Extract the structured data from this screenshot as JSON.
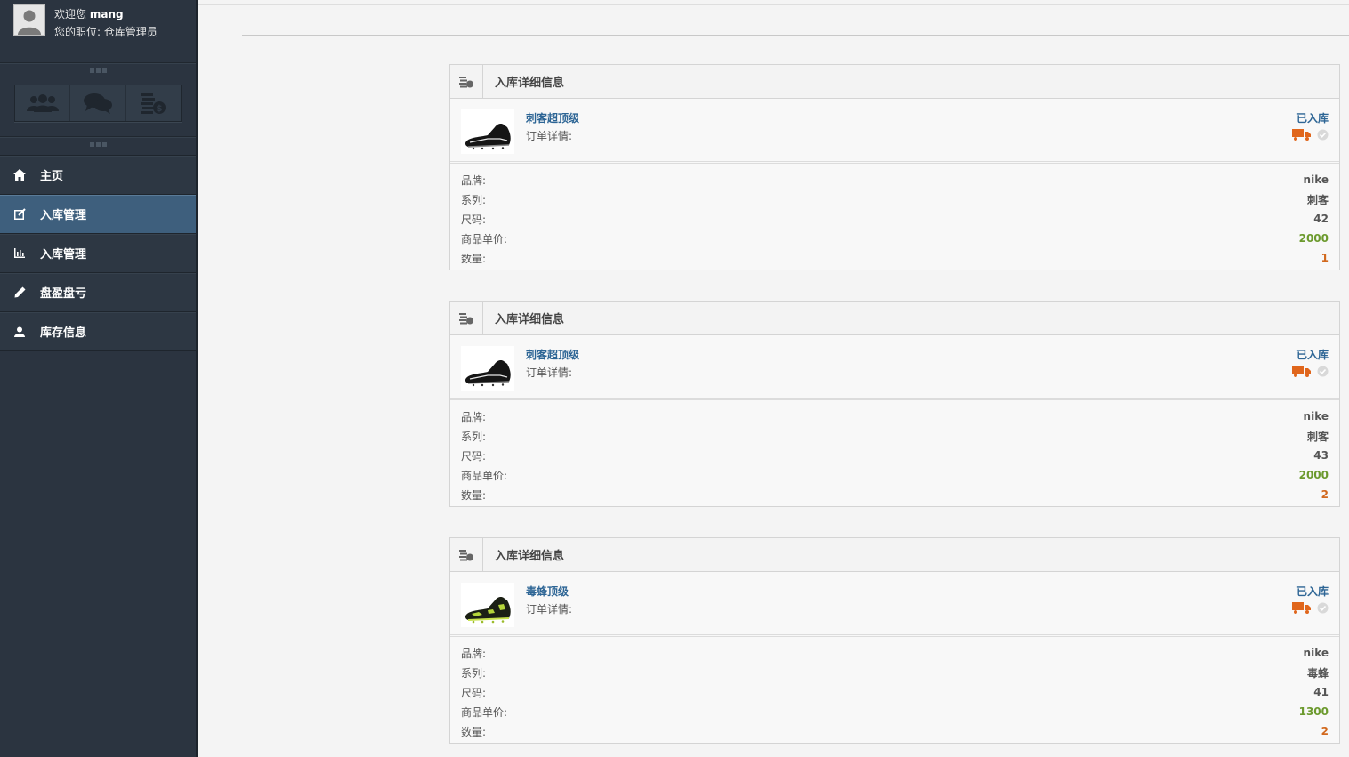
{
  "user": {
    "welcome_prefix": "欢迎您",
    "username": "mang",
    "role_label": "您的职位:",
    "role": "仓库管理员"
  },
  "shortcuts": [
    {
      "icon": "users-icon"
    },
    {
      "icon": "chat-icon"
    },
    {
      "icon": "coins-icon"
    }
  ],
  "nav": {
    "items": [
      {
        "label": "主页",
        "icon": "home-icon"
      },
      {
        "label": "入库管理",
        "icon": "edit-icon",
        "active": true
      },
      {
        "label": "入库管理",
        "icon": "bar-chart-icon"
      },
      {
        "label": "盘盈盘亏",
        "icon": "pencil-icon"
      },
      {
        "label": "库存信息",
        "icon": "user-icon"
      }
    ]
  },
  "panels": [
    {
      "title": "入库详细信息",
      "product_name": "刺客超顶级",
      "detail_label": "订单详情:",
      "status": "已入库",
      "rows": [
        {
          "key": "品牌:",
          "value": "nike"
        },
        {
          "key": "系列:",
          "value": "刺客"
        },
        {
          "key": "尺码:",
          "value": "42"
        },
        {
          "key": "商品单价:",
          "value": "2000"
        },
        {
          "key": "数量:",
          "value": "1"
        }
      ]
    },
    {
      "title": "入库详细信息",
      "product_name": "刺客超顶级",
      "detail_label": "订单详情:",
      "status": "已入库",
      "rows": [
        {
          "key": "品牌:",
          "value": "nike"
        },
        {
          "key": "系列:",
          "value": "刺客"
        },
        {
          "key": "尺码:",
          "value": "43"
        },
        {
          "key": "商品单价:",
          "value": "2000"
        },
        {
          "key": "数量:",
          "value": "2"
        }
      ]
    },
    {
      "title": "入库详细信息",
      "product_name": "毒蜂顶级",
      "detail_label": "订单详情:",
      "status": "已入库",
      "rows": [
        {
          "key": "品牌:",
          "value": "nike"
        },
        {
          "key": "系列:",
          "value": "毒蜂"
        },
        {
          "key": "尺码:",
          "value": "41"
        },
        {
          "key": "商品单价:",
          "value": "1300"
        },
        {
          "key": "数量:",
          "value": "2"
        }
      ]
    }
  ],
  "colors": {
    "sidebar_bg": "#2b3440",
    "nav_active": "#3e5f7d",
    "link_blue": "#2d6595",
    "price_green": "#6c9a2e",
    "qty_orange": "#d2691e",
    "truck_orange": "#e0661c"
  }
}
